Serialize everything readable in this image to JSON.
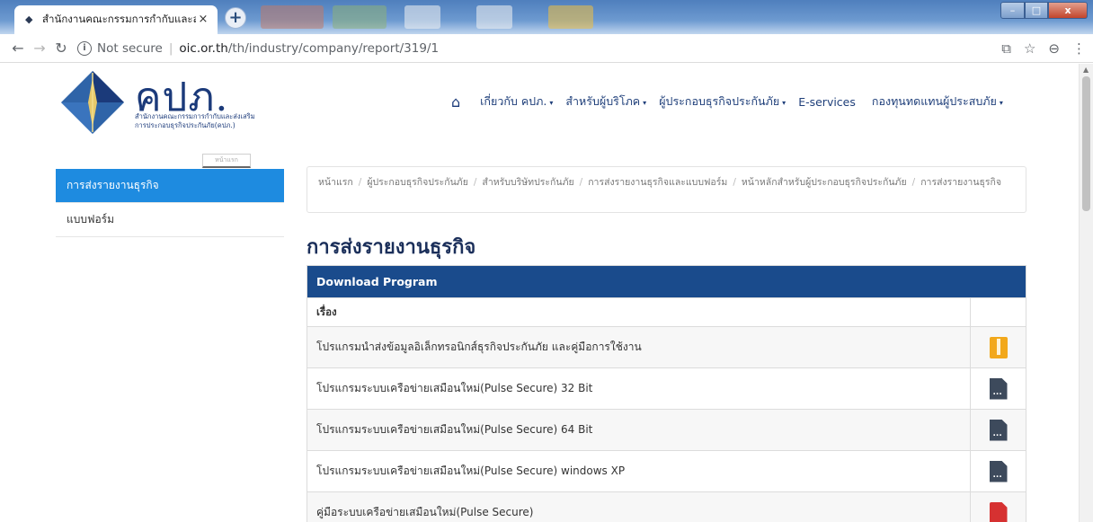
{
  "browser": {
    "tab_title": "สำนักงานคณะกรรมการกำกับและส่",
    "tab_close": "×",
    "new_tab": "+",
    "security_label": "Not secure",
    "url_host": "oic.or.th",
    "url_path": "/th/industry/company/report/319/1",
    "window_min": "–",
    "window_max": "□",
    "window_close": "x"
  },
  "site": {
    "logo_text": "คปภ.",
    "logo_sub1": "สำนักงานคณะกรรมการกำกับและส่งเสริม",
    "logo_sub2": "การประกอบธุรกิจประกันภัย(คปภ.)",
    "nav": [
      {
        "label": "เกี่ยวกับ คปภ."
      },
      {
        "label": "สำหรับผู้บริโภค"
      },
      {
        "label": "ผู้ประกอบธุรกิจประกันภัย"
      },
      {
        "label": "E-services"
      },
      {
        "label": "กองทุนทดแทนผู้ประสบภัย"
      }
    ]
  },
  "sidebar": {
    "tag": "หน้าแรก",
    "items": [
      {
        "label": "การส่งรายงานธุรกิจ"
      },
      {
        "label": "แบบฟอร์ม"
      }
    ]
  },
  "breadcrumb": {
    "items": [
      "หน้าแรก",
      "ผู้ประกอบธุรกิจประกันภัย",
      "สำหรับบริษัทประกันภัย",
      "การส่งรายงานธุรกิจและแบบฟอร์ม",
      "หน้าหลักสำหรับผู้ประกอบธุรกิจประกันภัย",
      "การส่งรายงานธุรกิจ"
    ]
  },
  "main": {
    "title": "การส่งรายงานธุรกิจ",
    "table_title": "Download Program",
    "column_header": "เรื่อง",
    "rows": [
      {
        "label": "โปรแกรมนำส่งข้อมูลอิเล็กทรอนิกส์ธุรกิจประกันภัย และคู่มือการใช้งาน",
        "file_type": "zip"
      },
      {
        "label": "โปรแกรมระบบเครือข่ายเสมือนใหม่(Pulse Secure) 32 Bit",
        "file_type": "exe"
      },
      {
        "label": "โปรแกรมระบบเครือข่ายเสมือนใหม่(Pulse Secure) 64 Bit",
        "file_type": "exe"
      },
      {
        "label": "โปรแกรมระบบเครือข่ายเสมือนใหม่(Pulse Secure) windows XP",
        "file_type": "exe"
      },
      {
        "label": "คู่มือระบบเครือข่ายเสมือนใหม่(Pulse Secure)",
        "file_type": "pdf"
      }
    ]
  },
  "colors": {
    "brand": "#1b3a7a",
    "sidebar_active": "#1e8be0",
    "table_header": "#1a4b8c",
    "zip_icon": "#f2a81b",
    "exe_icon": "#3d4a5c",
    "pdf_icon": "#d63131"
  }
}
